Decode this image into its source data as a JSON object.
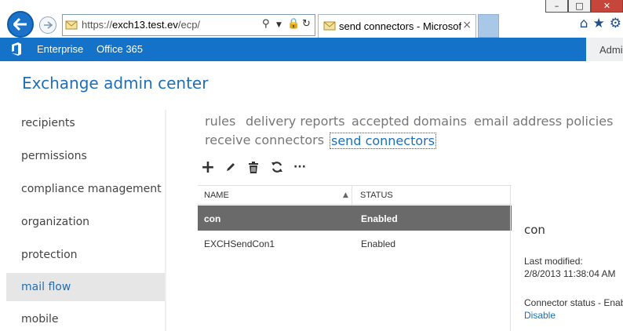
{
  "browser": {
    "address": "https://exch13.test.ev/ecp/",
    "address_host_prefix": "https://",
    "address_host": "exch13.test.ev",
    "address_path": "/ecp/",
    "tab_title": "send connectors - Microsof...",
    "tab_close": "×",
    "icons": [
      "back-arrow-icon",
      "forward-arrow-icon",
      "search-icon",
      "dropdown-icon",
      "lock-icon",
      "refresh-icon",
      "home-icon",
      "star-icon",
      "gear-icon"
    ],
    "win_controls": {
      "minimize": "–",
      "maximize": "□",
      "close": "✕"
    }
  },
  "suitebar": {
    "nav": [
      "Enterprise",
      "Office 365"
    ],
    "user": "Admi",
    "colors": {
      "bar": "#1473c9",
      "text": "#ffffff"
    }
  },
  "app": {
    "title": "Exchange admin center",
    "accent": "#1e6fb8"
  },
  "left_nav": {
    "items": [
      {
        "label": "recipients"
      },
      {
        "label": "permissions"
      },
      {
        "label": "compliance management"
      },
      {
        "label": "organization"
      },
      {
        "label": "protection"
      },
      {
        "label": "mail flow",
        "selected": true
      },
      {
        "label": "mobile"
      }
    ]
  },
  "tabs": [
    {
      "label": "rules"
    },
    {
      "label": "delivery reports"
    },
    {
      "label": "accepted domains"
    },
    {
      "label": "email address policies"
    },
    {
      "label": "receive connectors"
    },
    {
      "label": "send connectors",
      "active": true
    }
  ],
  "toolbar": {
    "icons": [
      "add-icon",
      "edit-icon",
      "delete-icon",
      "refresh-icon",
      "more-icon"
    ],
    "add": "+",
    "more": "···"
  },
  "table": {
    "columns": [
      "NAME",
      "STATUS"
    ],
    "sort_indicator": "▲",
    "rows": [
      {
        "name": "con",
        "status": "Enabled",
        "selected": true
      },
      {
        "name": "EXCHSendCon1",
        "status": "Enabled"
      }
    ]
  },
  "details": {
    "name": "con",
    "last_modified_label": "Last modified:",
    "last_modified_value": "2/8/2013 11:38:04 AM",
    "status_label": "Connector status - Enab",
    "action_link": "Disable"
  }
}
